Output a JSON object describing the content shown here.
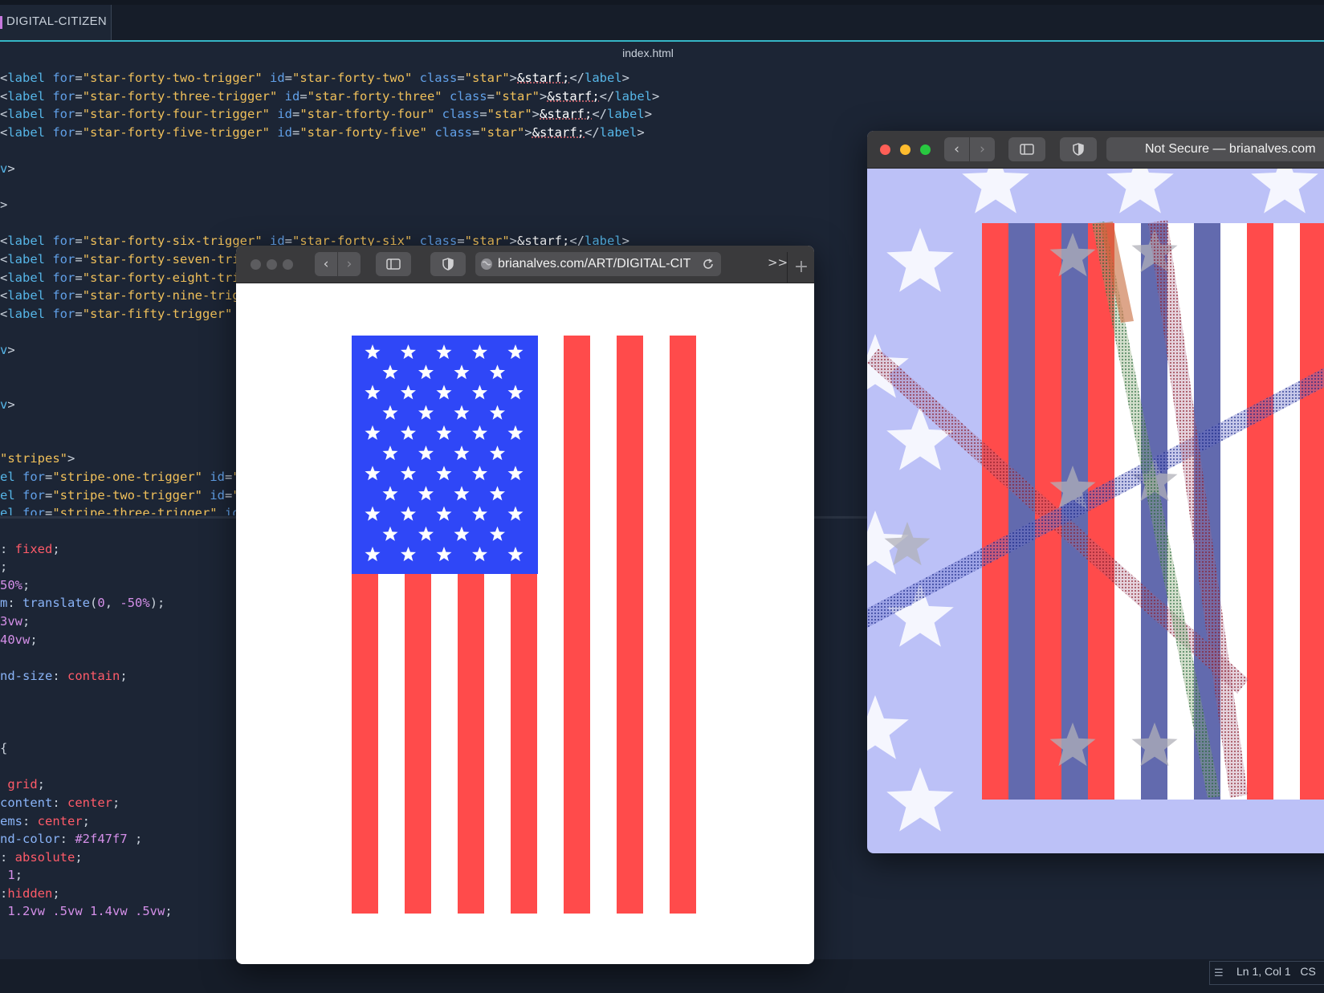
{
  "editor": {
    "tab_label": "DIGITAL-CITIZEN",
    "filename": "index.html",
    "status": "Ln 1, Col 1",
    "status_suffix": "CS"
  },
  "window_left": {
    "url": "brianalves.com/ART/DIGITAL-CITIZ",
    "overflow_label": ">>",
    "new_tab_label": "+",
    "colors": {
      "blue": "#2f47f7",
      "red": "#ff4b4b"
    }
  },
  "window_right": {
    "url": "Not Secure — brianalves.com",
    "colors": {
      "background": "#bcc1f7",
      "red": "#ff4b4b",
      "blue": "#626aae"
    }
  },
  "icons": {
    "back": "‹",
    "forward": "›",
    "sidebar": "sidebar-icon",
    "shield": "shield-icon",
    "reload": "reload-icon",
    "globe": "globe-icon",
    "star": "★"
  }
}
